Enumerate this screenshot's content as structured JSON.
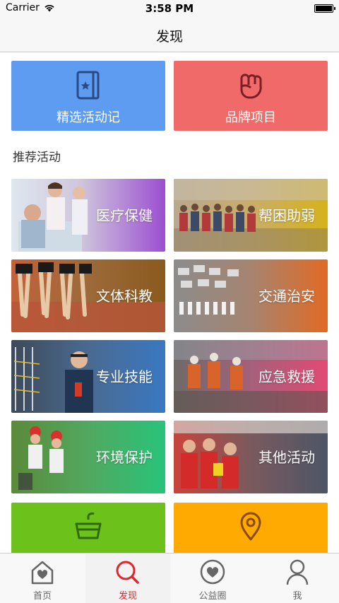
{
  "status_bar": {
    "carrier": "Carrier",
    "time": "3:58 PM"
  },
  "nav": {
    "title": "发现"
  },
  "featured": [
    {
      "label": "精选活动记",
      "color": "#5e9cf2",
      "icon": "book-star-icon"
    },
    {
      "label": "品牌项目",
      "color": "#f06a6a",
      "icon": "raised-fist-icon"
    }
  ],
  "section": {
    "title": "推荐活动"
  },
  "categories": [
    {
      "label": "医疗保健",
      "accent": "#9b4fd0"
    },
    {
      "label": "帮困助弱",
      "accent": "#d6b21a"
    },
    {
      "label": "文体科教",
      "accent": "#8a5a1e"
    },
    {
      "label": "交通治安",
      "accent": "#e06a25"
    },
    {
      "label": "专业技能",
      "accent": "#3a78c2"
    },
    {
      "label": "应急救援",
      "accent": "#e14a74"
    },
    {
      "label": "环境保护",
      "accent": "#29c37a"
    },
    {
      "label": "其他活动",
      "accent": "#4d5566"
    }
  ],
  "bottom_tiles": [
    {
      "color": "#6cc21a",
      "icon": "basket-icon"
    },
    {
      "color": "#ffaa00",
      "icon": "location-pin-icon"
    }
  ],
  "tab_bar": {
    "tabs": [
      {
        "label": "首页",
        "icon": "home-heart-icon"
      },
      {
        "label": "发现",
        "icon": "search-icon",
        "active": true
      },
      {
        "label": "公益圈",
        "icon": "heart-circle-icon"
      },
      {
        "label": "我",
        "icon": "person-icon"
      }
    ]
  }
}
